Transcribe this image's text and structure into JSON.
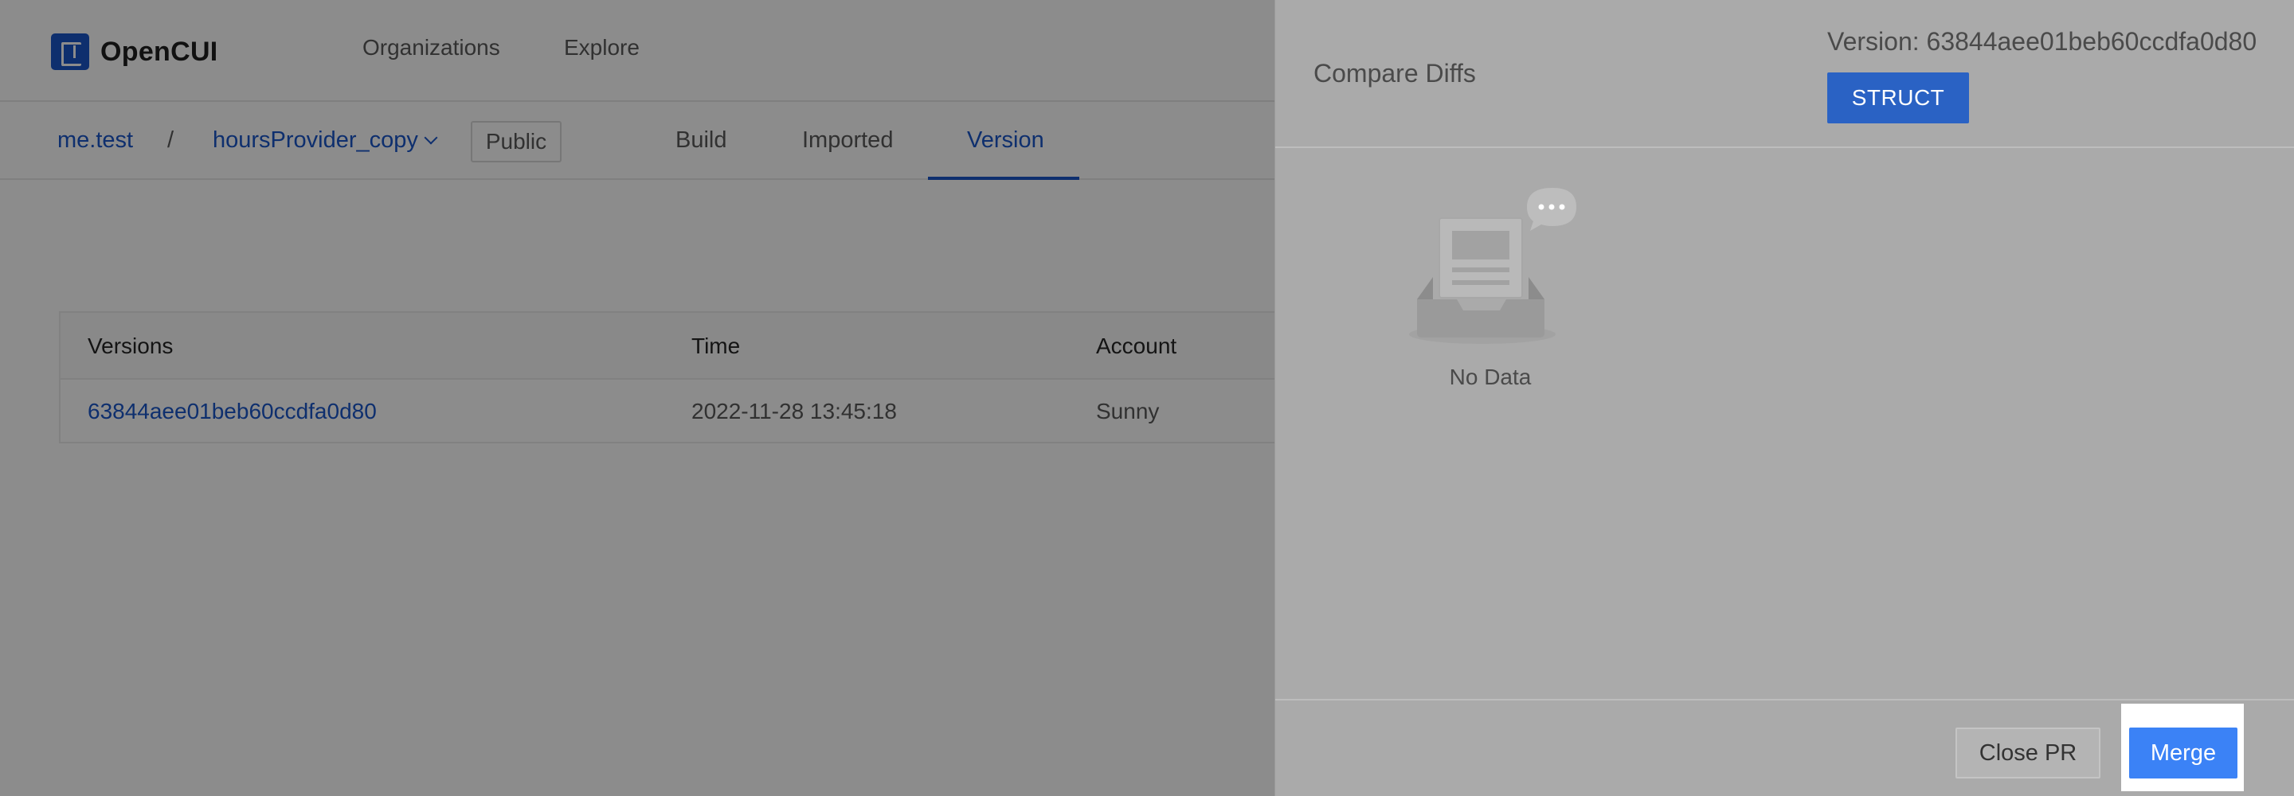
{
  "app": {
    "logo_text": "OpenCUI"
  },
  "topnav": {
    "items": [
      {
        "label": "Organizations"
      },
      {
        "label": "Explore"
      }
    ]
  },
  "breadcrumb": {
    "org": "me.test",
    "separator": "/",
    "project": "hoursProvider_copy",
    "visibility": "Public"
  },
  "tabs": [
    {
      "label": "Build",
      "active": false
    },
    {
      "label": "Imported",
      "active": false
    },
    {
      "label": "Version",
      "active": true
    }
  ],
  "table": {
    "columns": [
      "Versions",
      "Time",
      "Account"
    ],
    "rows": [
      {
        "version": "63844aee01beb60ccdfa0d80",
        "time": "2022-11-28 13:45:18",
        "account": "Sunny"
      }
    ]
  },
  "drawer": {
    "title": "Compare Diffs",
    "version_label": "Version: 63844aee01beb60ccdfa0d80",
    "struct_button": "STRUCT",
    "empty_text": "No Data",
    "close_button": "Close PR",
    "merge_button": "Merge"
  },
  "colors": {
    "brand": "#1a56c9",
    "merge": "#3b82f6",
    "struct": "#2a62c4"
  }
}
